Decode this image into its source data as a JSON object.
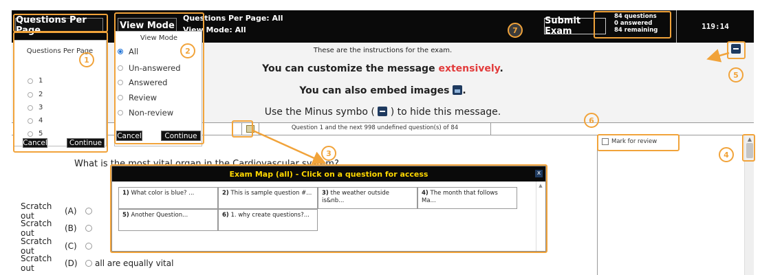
{
  "header": {
    "qpp_button": "Questions Per Page",
    "viewmode_button": "View Mode",
    "info_qpp": "Questions Per Page: All",
    "info_viewmode": "View Mode: All",
    "submit_button": "Submit Exam",
    "counts": {
      "questions": "84 questions",
      "answered": "0 answered",
      "remaining": "84 remaining"
    },
    "timer": "119:14"
  },
  "instructions": {
    "line1": "These are the instructions for the exam.",
    "line2_prefix": "You can customize the message ",
    "line2_highlight": "extensively",
    "line2_suffix": ".",
    "line3_prefix": "You can also embed images ",
    "line3_suffix": ".",
    "line4_prefix": "Use the Minus symbo ( ",
    "line4_suffix": " ) to hide this message."
  },
  "question_nav": {
    "status": "Question 1 and the next 998 undefined question(s) of 84"
  },
  "question": {
    "text": "What is the most vital organ in the Cardiovascular system?",
    "scratch_label": "Scratch out",
    "answers": [
      {
        "letter": "(A)",
        "text": ""
      },
      {
        "letter": "(B)",
        "text": ""
      },
      {
        "letter": "(C)",
        "text": ""
      },
      {
        "letter": "(D)",
        "text": "all are equally vital"
      }
    ]
  },
  "review": {
    "label": "Mark for review"
  },
  "qpp_panel": {
    "title": "Questions Per Page",
    "options": [
      "1",
      "2",
      "3",
      "4",
      "5"
    ],
    "cancel": "Cancel",
    "continue": "Continue"
  },
  "viewmode_panel": {
    "title": "View Mode",
    "options": [
      "All",
      "Un-answered",
      "Answered",
      "Review",
      "Non-review"
    ],
    "selected": "All",
    "cancel": "Cancel",
    "continue": "Continue"
  },
  "exam_map": {
    "title": "Exam Map (all) - Click on a question for access",
    "close": "x",
    "items": [
      {
        "num": "1)",
        "text": " What color is blue? ..."
      },
      {
        "num": "2)",
        "text": " This is sample question #..."
      },
      {
        "num": "3)",
        "text": " the weather outside is&nb..."
      },
      {
        "num": "4)",
        "text": " The month that follows Ma..."
      },
      {
        "num": "5)",
        "text": " Another Question..."
      },
      {
        "num": "6)",
        "text": " 1. why create questions?..."
      }
    ]
  },
  "callouts": [
    "1",
    "2",
    "3",
    "4",
    "5",
    "6",
    "7"
  ],
  "colors": {
    "annotation": "#f1a33a",
    "header_bg": "#0a0a0a",
    "map_title": "#ffd700",
    "highlight": "#e23c3c",
    "icon_navy": "#1f3a5f"
  }
}
